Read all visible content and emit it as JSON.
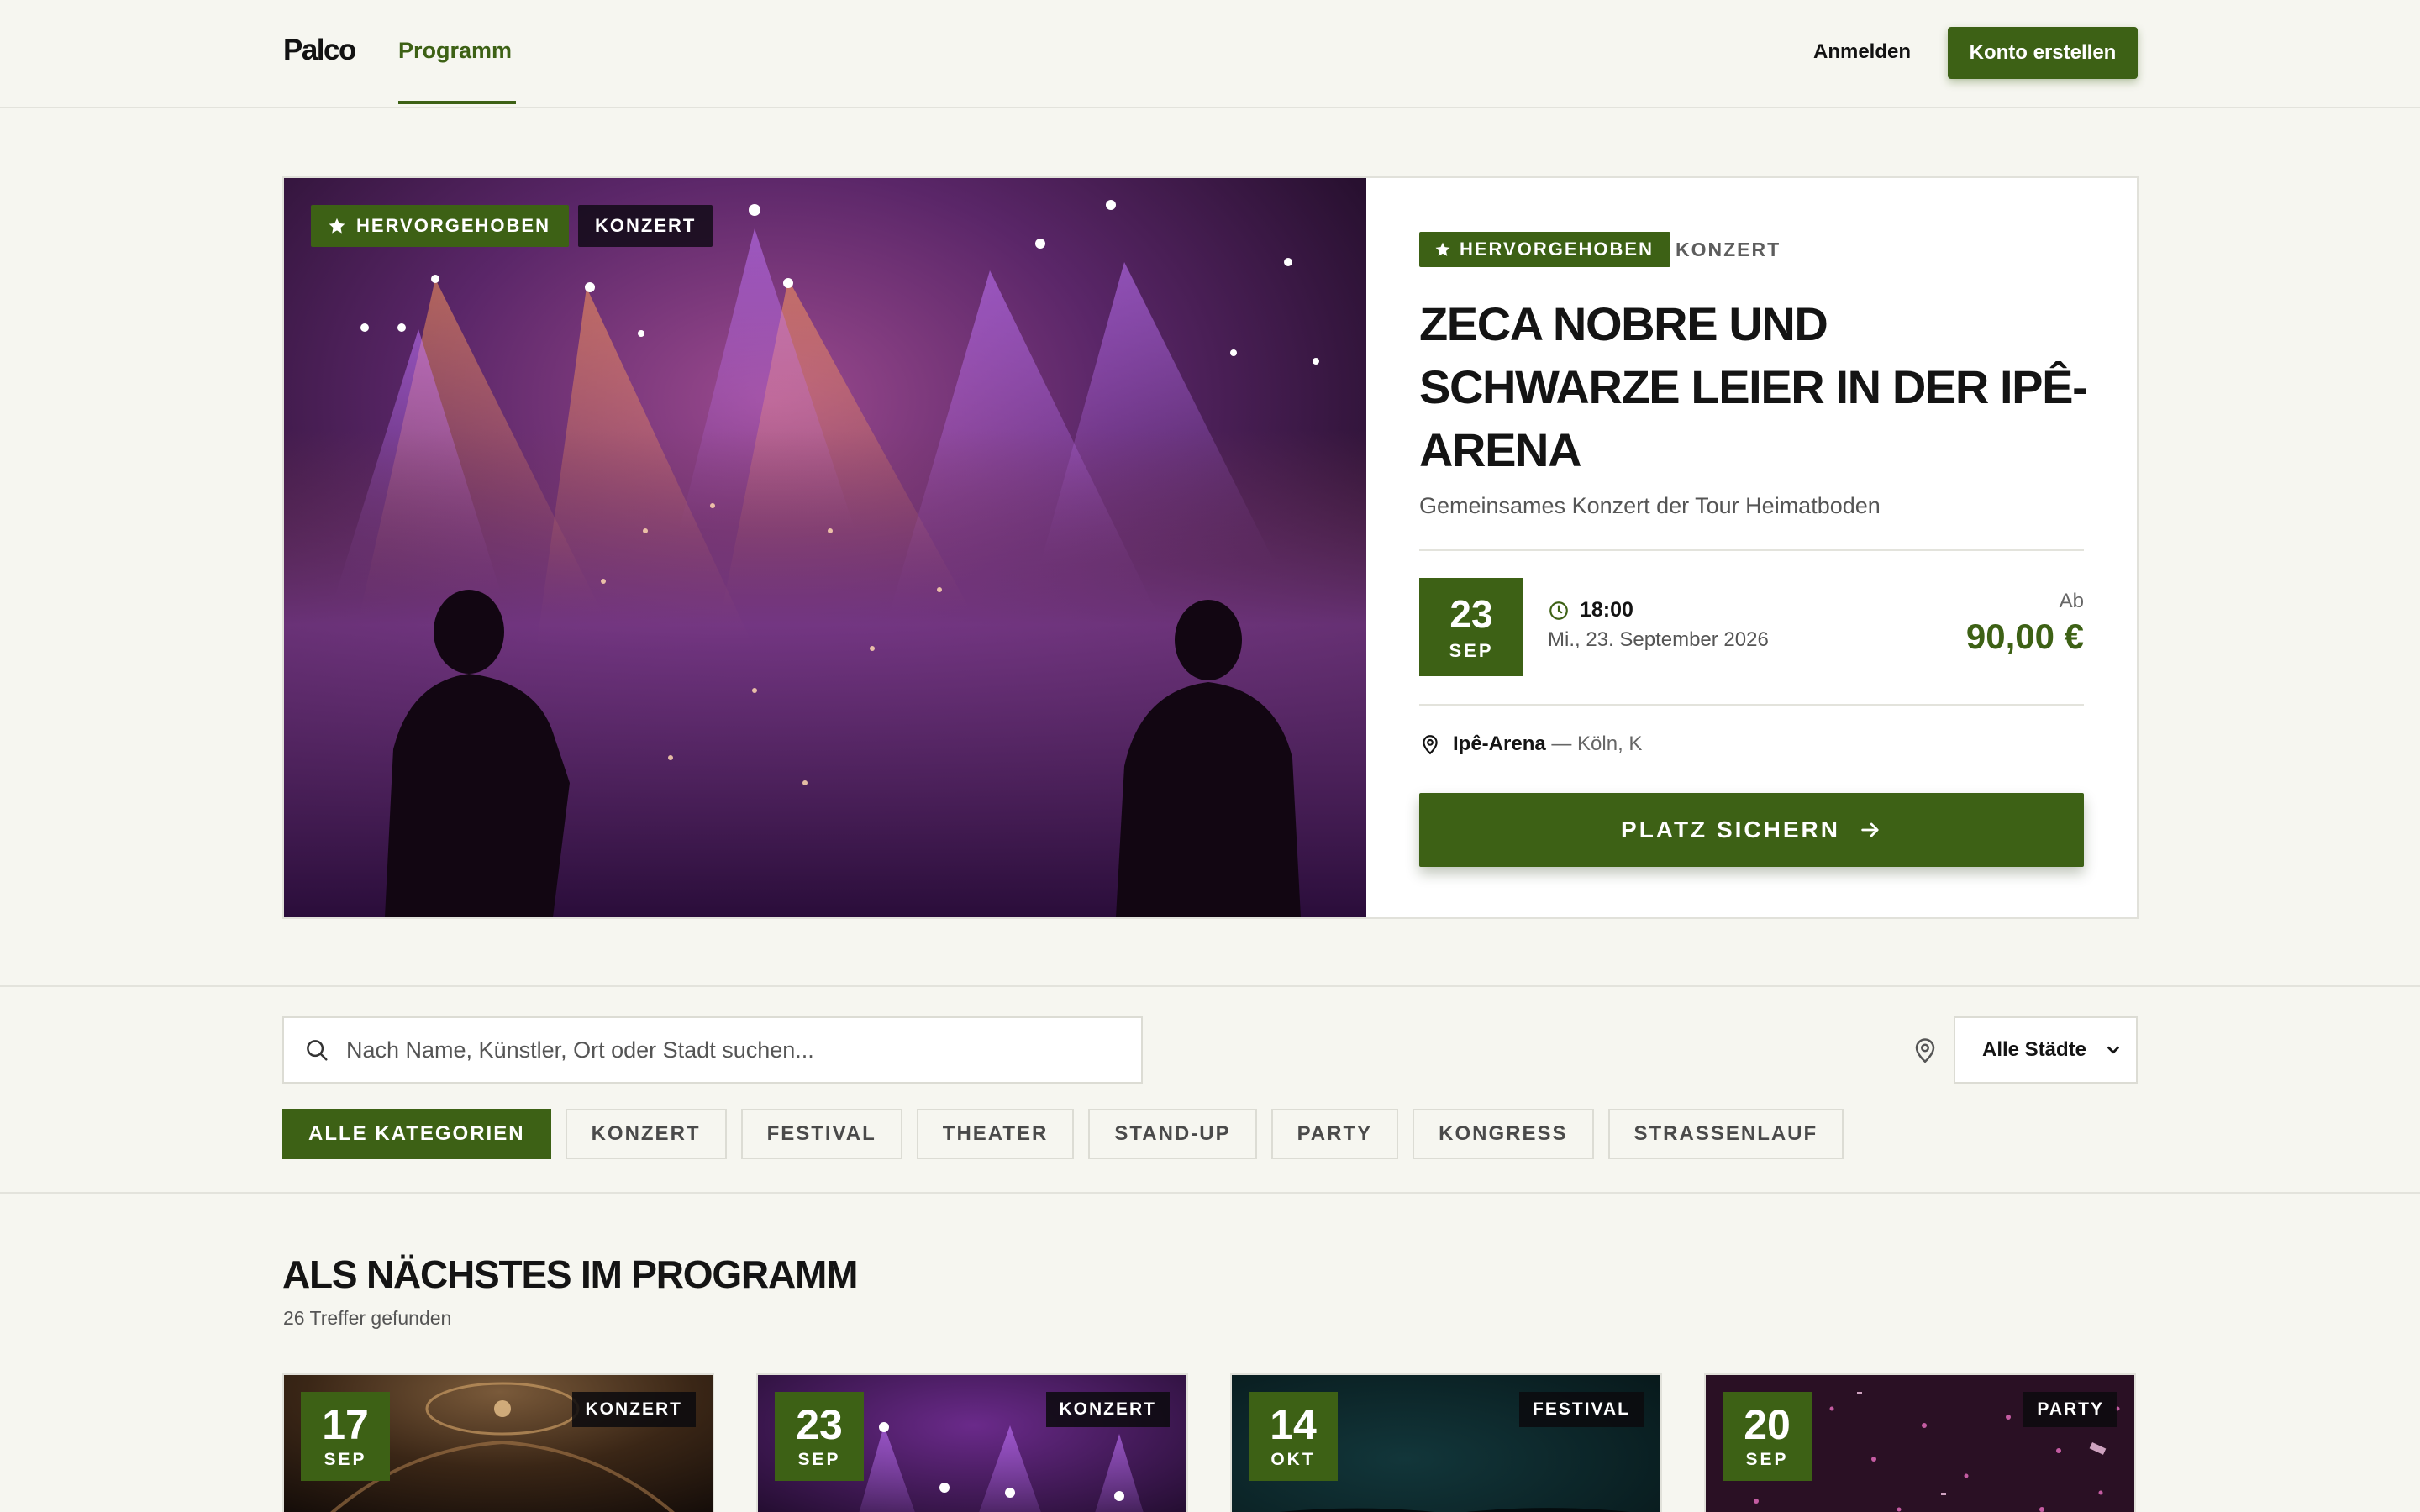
{
  "header": {
    "brand": "Palco",
    "nav_tab": "Programm",
    "login": "Anmelden",
    "signup": "Konto erstellen"
  },
  "hero": {
    "featured_label": "HERVORGEHOBEN",
    "category": "KONZERT",
    "title": "ZECA NOBRE UND SCHWARZE LEIER IN DER IPÊ-ARENA",
    "subtitle": "Gemeinsames Konzert der Tour Heimatboden",
    "date_day": "23",
    "date_month": "SEP",
    "time": "18:00",
    "date_long": "Mi., 23. September 2026",
    "price_label": "Ab",
    "price": "90,00 €",
    "venue_name": "Ipê-Arena",
    "venue_location": "— Köln, K",
    "cta": "PLATZ SICHERN",
    "icons": {
      "featured": "star-icon",
      "time": "clock-icon",
      "venue": "map-pin-icon",
      "cta": "arrow-right-icon"
    }
  },
  "filters": {
    "search_placeholder": "Nach Name, Künstler, Ort oder Stadt suchen...",
    "city_select": "Alle Städte",
    "categories": [
      {
        "label": "ALLE KATEGORIEN",
        "active": true
      },
      {
        "label": "KONZERT",
        "active": false
      },
      {
        "label": "FESTIVAL",
        "active": false
      },
      {
        "label": "THEATER",
        "active": false
      },
      {
        "label": "STAND-UP",
        "active": false
      },
      {
        "label": "PARTY",
        "active": false
      },
      {
        "label": "KONGRESS",
        "active": false
      },
      {
        "label": "STRASSENLAUF",
        "active": false
      }
    ]
  },
  "results": {
    "title": "ALS NÄCHSTES IM PROGRAMM",
    "count_text": "26 Treffer gefunden",
    "cards": [
      {
        "day": "17",
        "month": "SEP",
        "category": "KONZERT"
      },
      {
        "day": "23",
        "month": "SEP",
        "category": "KONZERT"
      },
      {
        "day": "14",
        "month": "OKT",
        "category": "FESTIVAL"
      },
      {
        "day": "20",
        "month": "SEP",
        "category": "PARTY"
      }
    ]
  },
  "colors": {
    "accent": "#3d6115",
    "background": "#f6f6f0",
    "border": "#e1e1da"
  }
}
